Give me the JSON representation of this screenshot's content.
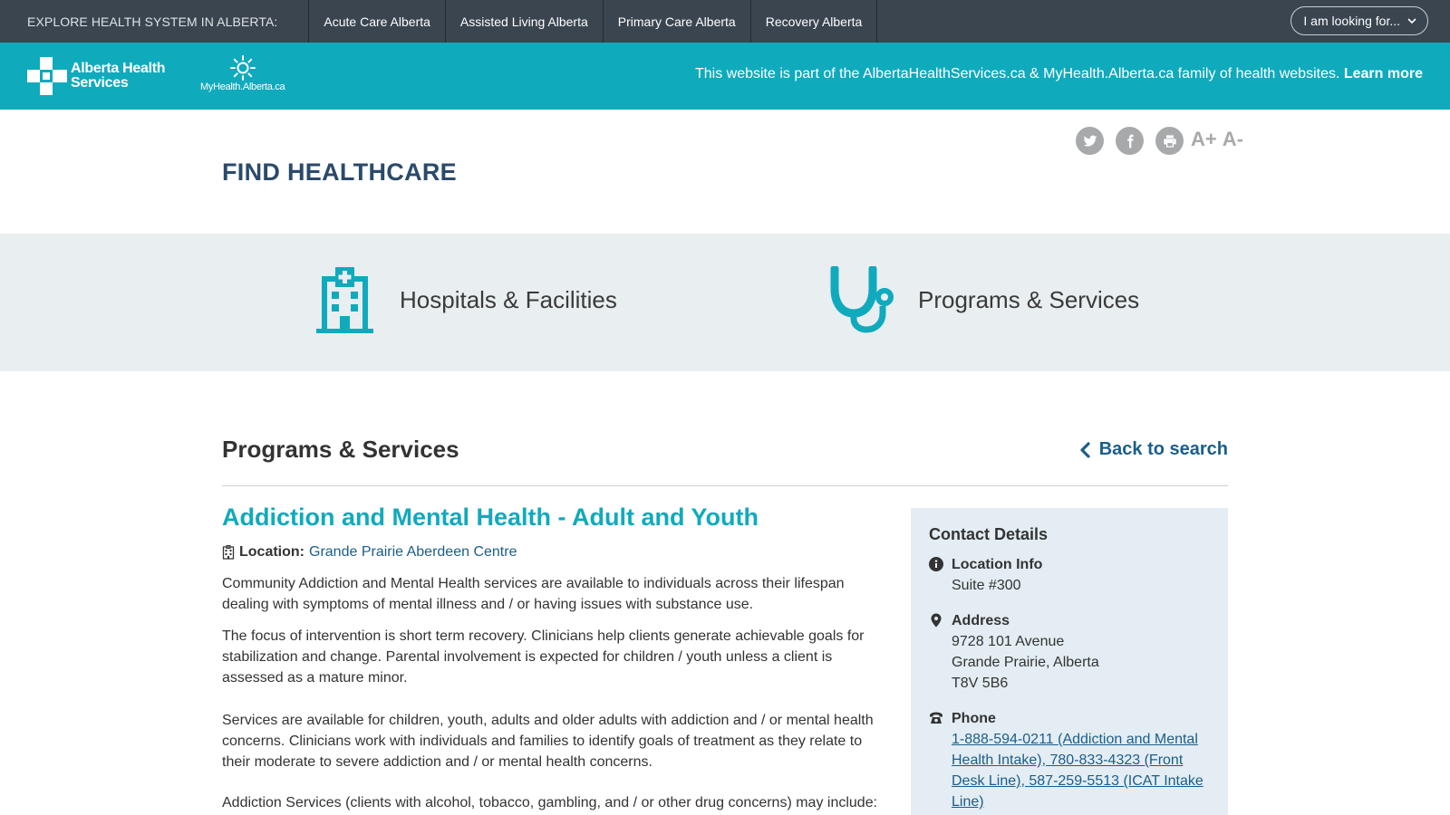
{
  "topbar": {
    "explore_label": "EXPLORE HEALTH SYSTEM IN ALBERTA:",
    "nav": [
      {
        "label": "Acute Care Alberta"
      },
      {
        "label": "Assisted Living Alberta"
      },
      {
        "label": "Primary Care Alberta"
      },
      {
        "label": "Recovery Alberta"
      }
    ],
    "looking_for": "I am looking for..."
  },
  "brand": {
    "ahs_logo_line1": "Alberta Health",
    "ahs_logo_line2": "Services",
    "myhealth_logo": "MyHealth.Alberta.ca",
    "message": "This website is part of the AlbertaHealthServices.ca & MyHealth.Alberta.ca family of health websites.",
    "learn_more": "Learn more"
  },
  "header": {
    "title": "FIND HEALTHCARE",
    "font_increase": "A+",
    "font_decrease": "A-",
    "social_icons": [
      "twitter-icon",
      "facebook-icon",
      "print-icon"
    ]
  },
  "categories": [
    {
      "label": "Hospitals & Facilities",
      "icon": "hospital-icon"
    },
    {
      "label": "Programs & Services",
      "icon": "stethoscope-icon"
    }
  ],
  "section": {
    "title": "Programs & Services",
    "back_label": "Back to search"
  },
  "program": {
    "title": "Addiction and Mental Health - Adult and Youth",
    "location_label": "Location:",
    "location_value": "Grande Prairie Aberdeen Centre",
    "paragraphs": [
      "Community Addiction and Mental Health services are available to individuals across their lifespan dealing with symptoms of mental illness and / or having issues with substance use.",
      "The focus of intervention is short term recovery. Clinicians help clients generate achievable goals for stabilization and change. Parental involvement is expected for children / youth unless a client is assessed as a mature minor.",
      "Services are available for children, youth, adults and older adults with addiction and / or mental health concerns. Clinicians work with individuals and families to identify goals of treatment as they relate to their moderate to severe addiction and / or mental health concerns.",
      "Addiction Services (clients with alcohol, tobacco, gambling, and / or other drug concerns) may include:"
    ]
  },
  "contact": {
    "heading": "Contact Details",
    "location_info_label": "Location Info",
    "location_info_value": "Suite #300",
    "address_label": "Address",
    "address_line1": "9728 101 Avenue",
    "address_line2": "Grande Prairie, Alberta",
    "address_line3": "T8V 5B6",
    "phone_label": "Phone",
    "phone_value": "1-888-594-0211 (Addiction and Mental Health Intake), 780-833-4323 (Front Desk Line), 587-259-5513 (ICAT Intake Line)"
  },
  "colors": {
    "topbar": "#3a4550",
    "brand_teal": "#10aabd",
    "title_navy": "#2b4a6b",
    "link_blue": "#1b5e8a",
    "band_bg": "#e9eef1",
    "card_bg": "#e3edf3"
  }
}
